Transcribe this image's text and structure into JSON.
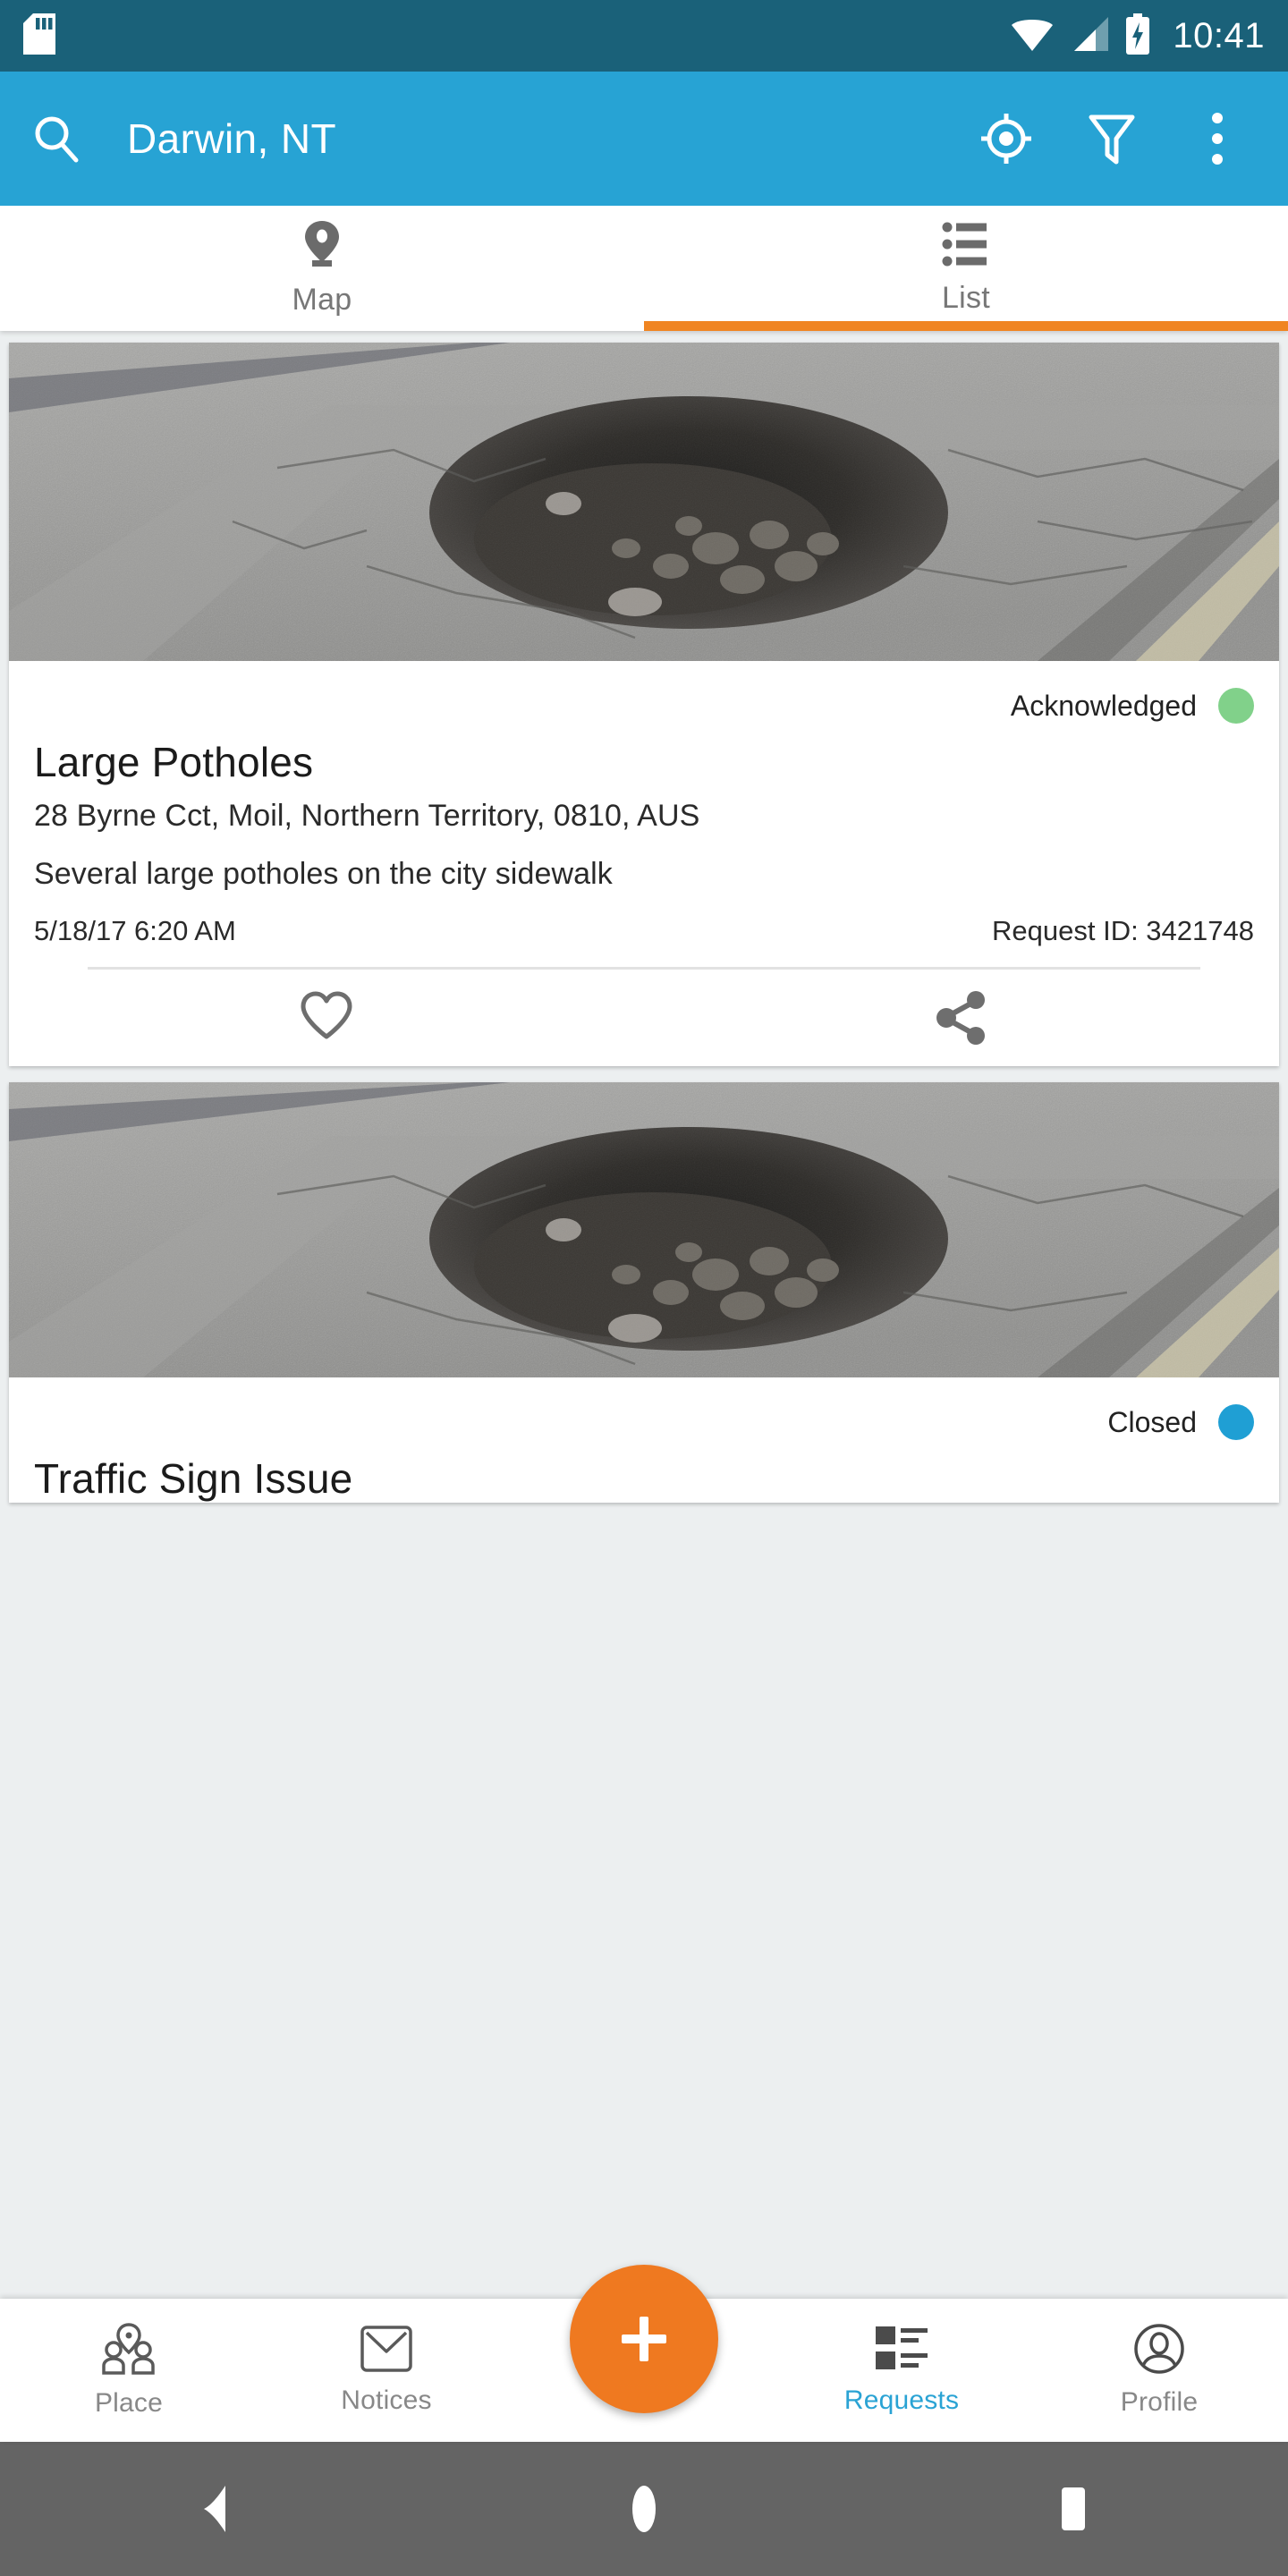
{
  "status_bar": {
    "sd_card_icon": "sd-card-icon",
    "wifi_icon": "wifi-icon",
    "signal_icon": "cellular-signal-icon",
    "battery_icon": "battery-charging-icon",
    "clock": "10:41"
  },
  "app_bar": {
    "search_icon": "search-icon",
    "title": "Darwin, NT",
    "locate_icon": "my-location-icon",
    "filter_icon": "filter-icon",
    "overflow_icon": "more-vertical-icon",
    "background": "#27a3d4"
  },
  "tabs": {
    "active_index": 1,
    "indicator_color": "#f08522",
    "items": [
      {
        "label": "Map",
        "icon": "map-pin-icon"
      },
      {
        "label": "List",
        "icon": "list-icon"
      }
    ]
  },
  "requests": [
    {
      "status": "Acknowledged",
      "status_color": "#81d18a",
      "title": "Large Potholes",
      "address": "28 Byrne Cct, Moil, Northern Territory, 0810, AUS",
      "description": "Several large potholes on the city sidewalk",
      "timestamp": "5/18/17 6:20 AM",
      "request_id": "Request ID: 3421748",
      "photo_alt": "pothole-photo",
      "favorite_icon": "heart-outline-icon",
      "share_icon": "share-icon"
    },
    {
      "status": "Closed",
      "status_color": "#1f9fd4",
      "title": "Traffic Sign Issue",
      "photo_alt": "pothole-photo"
    }
  ],
  "bottom_nav": {
    "active": "Requests",
    "active_color": "#2aa3d4",
    "fab": {
      "icon": "plus-icon",
      "color": "#ef7920"
    },
    "items": [
      {
        "label": "Place",
        "icon": "place-people-icon"
      },
      {
        "label": "Notices",
        "icon": "envelope-icon"
      },
      {
        "label": "Requests",
        "icon": "requests-list-icon"
      },
      {
        "label": "Profile",
        "icon": "profile-circle-icon"
      }
    ]
  },
  "system_nav": {
    "back_icon": "back-triangle-icon",
    "home_icon": "home-circle-icon",
    "recents_icon": "recents-square-icon"
  }
}
